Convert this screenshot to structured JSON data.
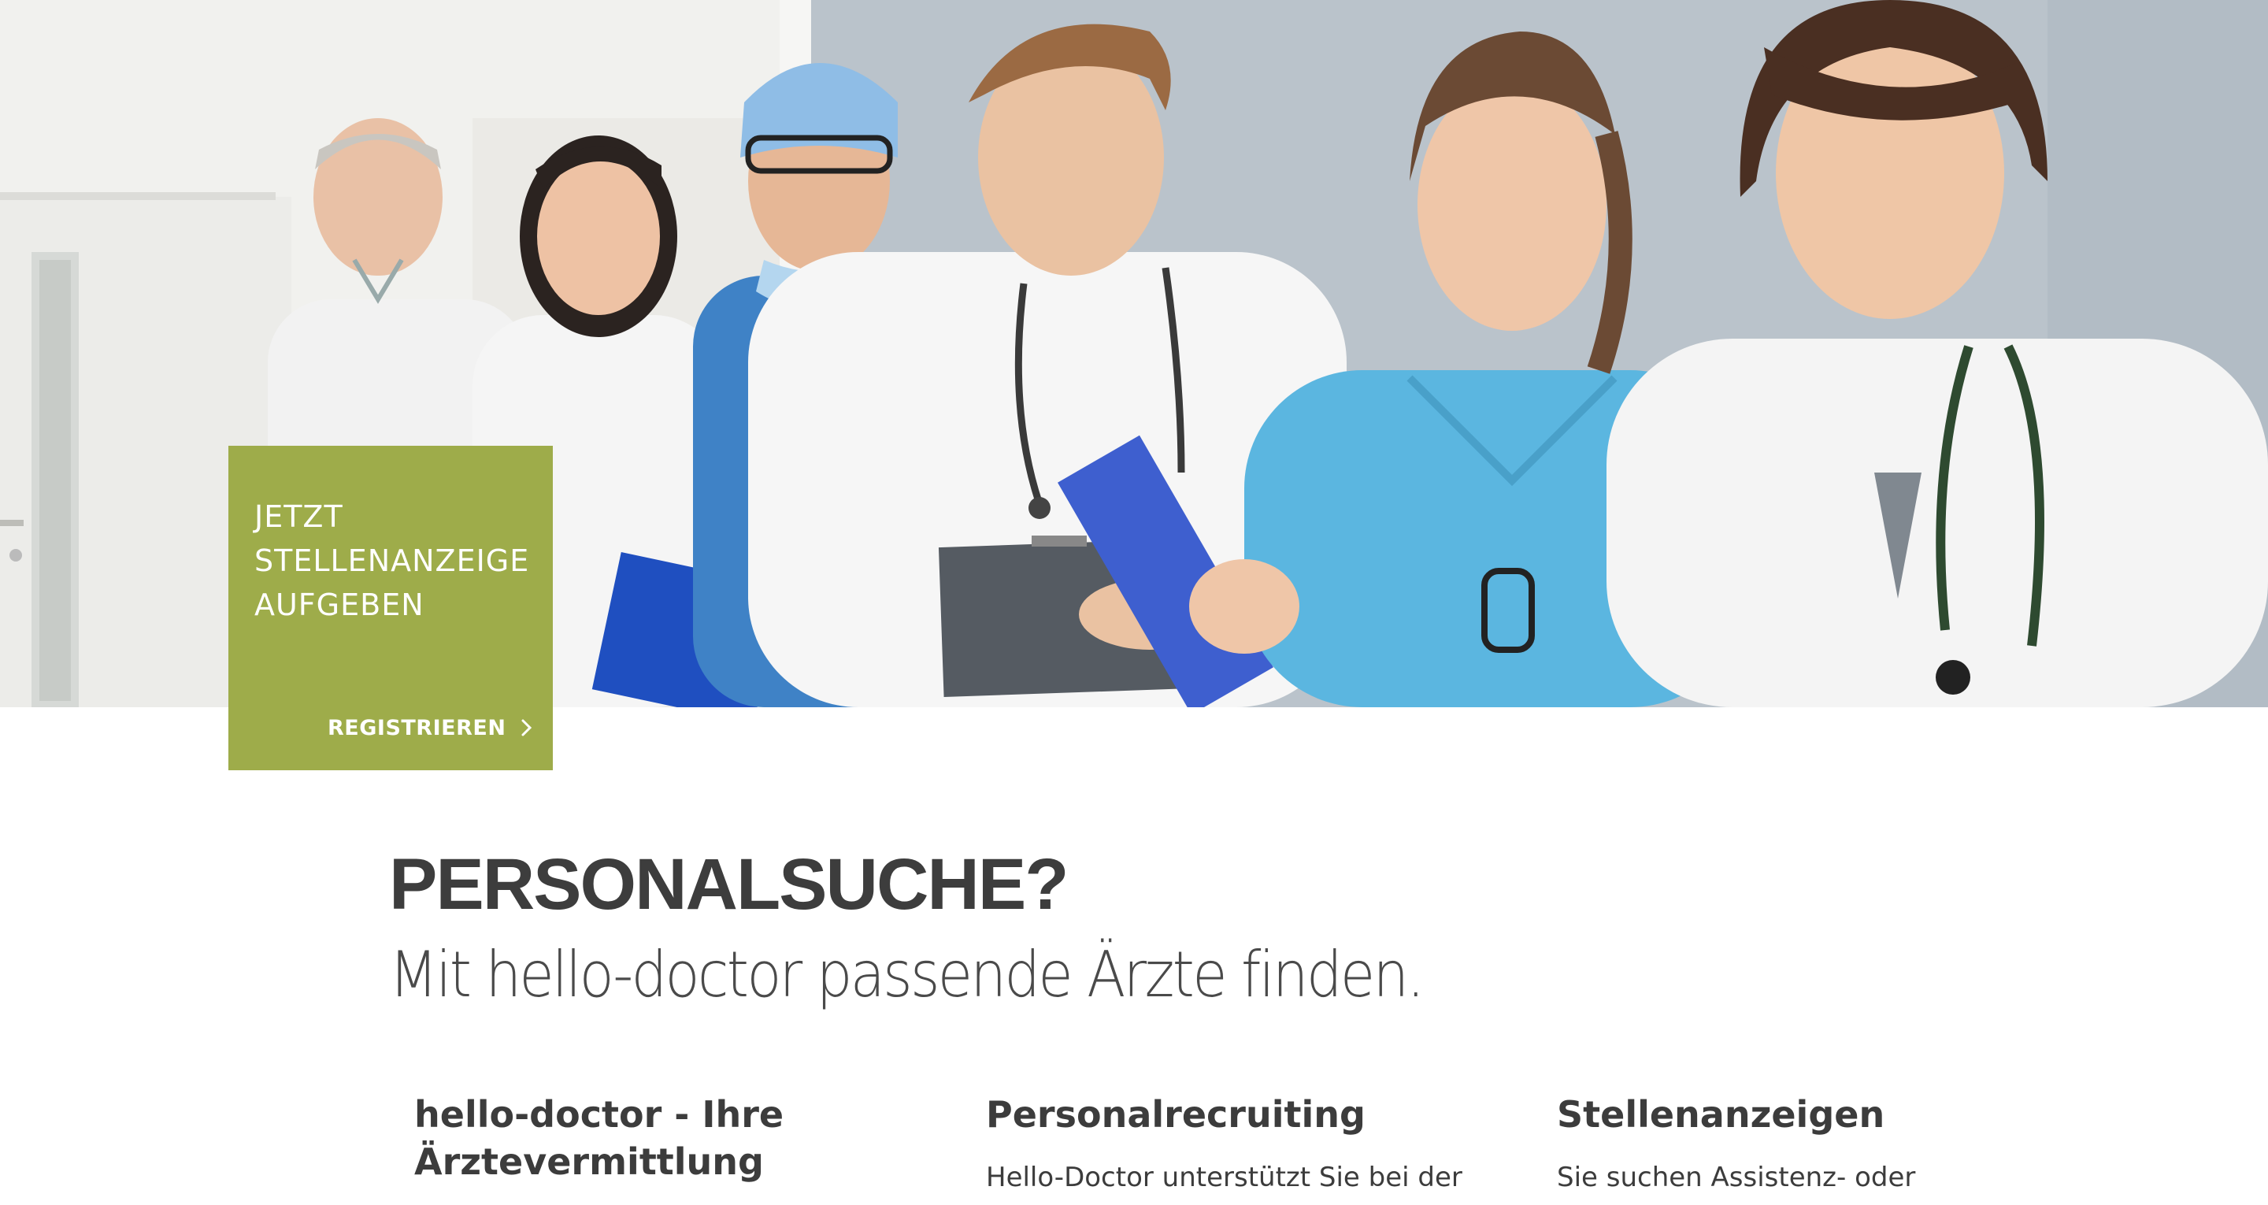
{
  "hero": {
    "image_alt_description": "",
    "cta": {
      "text": "JETZT\nSTELLENANZEIGE\nAUFGEBEN",
      "button_label": "REGISTRIEREN",
      "button_icon": "chevron-right-icon",
      "color": "#9eac4a"
    }
  },
  "intro": {
    "headline": "PERSONALSUCHE?",
    "subline": "Mit hello-doctor passende Ärzte finden."
  },
  "columns": [
    {
      "title": "hello-doctor - Ihre Ärztevermittlung",
      "text": ""
    },
    {
      "title": "Personalrecruiting",
      "text": "Hello-Doctor unterstützt Sie bei der"
    },
    {
      "title": "Stellenanzeigen",
      "text": "Sie suchen Assistenz- oder Fachärzte? Als"
    }
  ]
}
